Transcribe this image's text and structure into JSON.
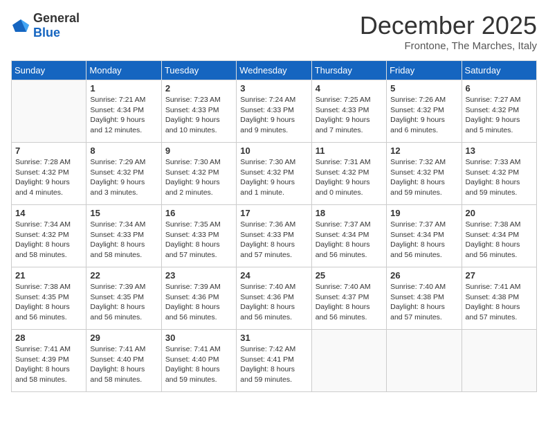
{
  "header": {
    "logo_general": "General",
    "logo_blue": "Blue",
    "month_title": "December 2025",
    "subtitle": "Frontone, The Marches, Italy"
  },
  "days_of_week": [
    "Sunday",
    "Monday",
    "Tuesday",
    "Wednesday",
    "Thursday",
    "Friday",
    "Saturday"
  ],
  "weeks": [
    [
      {
        "day": "",
        "info": ""
      },
      {
        "day": "1",
        "info": "Sunrise: 7:21 AM\nSunset: 4:34 PM\nDaylight: 9 hours\nand 12 minutes."
      },
      {
        "day": "2",
        "info": "Sunrise: 7:23 AM\nSunset: 4:33 PM\nDaylight: 9 hours\nand 10 minutes."
      },
      {
        "day": "3",
        "info": "Sunrise: 7:24 AM\nSunset: 4:33 PM\nDaylight: 9 hours\nand 9 minutes."
      },
      {
        "day": "4",
        "info": "Sunrise: 7:25 AM\nSunset: 4:33 PM\nDaylight: 9 hours\nand 7 minutes."
      },
      {
        "day": "5",
        "info": "Sunrise: 7:26 AM\nSunset: 4:32 PM\nDaylight: 9 hours\nand 6 minutes."
      },
      {
        "day": "6",
        "info": "Sunrise: 7:27 AM\nSunset: 4:32 PM\nDaylight: 9 hours\nand 5 minutes."
      }
    ],
    [
      {
        "day": "7",
        "info": "Sunrise: 7:28 AM\nSunset: 4:32 PM\nDaylight: 9 hours\nand 4 minutes."
      },
      {
        "day": "8",
        "info": "Sunrise: 7:29 AM\nSunset: 4:32 PM\nDaylight: 9 hours\nand 3 minutes."
      },
      {
        "day": "9",
        "info": "Sunrise: 7:30 AM\nSunset: 4:32 PM\nDaylight: 9 hours\nand 2 minutes."
      },
      {
        "day": "10",
        "info": "Sunrise: 7:30 AM\nSunset: 4:32 PM\nDaylight: 9 hours\nand 1 minute."
      },
      {
        "day": "11",
        "info": "Sunrise: 7:31 AM\nSunset: 4:32 PM\nDaylight: 9 hours\nand 0 minutes."
      },
      {
        "day": "12",
        "info": "Sunrise: 7:32 AM\nSunset: 4:32 PM\nDaylight: 8 hours\nand 59 minutes."
      },
      {
        "day": "13",
        "info": "Sunrise: 7:33 AM\nSunset: 4:32 PM\nDaylight: 8 hours\nand 59 minutes."
      }
    ],
    [
      {
        "day": "14",
        "info": "Sunrise: 7:34 AM\nSunset: 4:32 PM\nDaylight: 8 hours\nand 58 minutes."
      },
      {
        "day": "15",
        "info": "Sunrise: 7:34 AM\nSunset: 4:33 PM\nDaylight: 8 hours\nand 58 minutes."
      },
      {
        "day": "16",
        "info": "Sunrise: 7:35 AM\nSunset: 4:33 PM\nDaylight: 8 hours\nand 57 minutes."
      },
      {
        "day": "17",
        "info": "Sunrise: 7:36 AM\nSunset: 4:33 PM\nDaylight: 8 hours\nand 57 minutes."
      },
      {
        "day": "18",
        "info": "Sunrise: 7:37 AM\nSunset: 4:34 PM\nDaylight: 8 hours\nand 56 minutes."
      },
      {
        "day": "19",
        "info": "Sunrise: 7:37 AM\nSunset: 4:34 PM\nDaylight: 8 hours\nand 56 minutes."
      },
      {
        "day": "20",
        "info": "Sunrise: 7:38 AM\nSunset: 4:34 PM\nDaylight: 8 hours\nand 56 minutes."
      }
    ],
    [
      {
        "day": "21",
        "info": "Sunrise: 7:38 AM\nSunset: 4:35 PM\nDaylight: 8 hours\nand 56 minutes."
      },
      {
        "day": "22",
        "info": "Sunrise: 7:39 AM\nSunset: 4:35 PM\nDaylight: 8 hours\nand 56 minutes."
      },
      {
        "day": "23",
        "info": "Sunrise: 7:39 AM\nSunset: 4:36 PM\nDaylight: 8 hours\nand 56 minutes."
      },
      {
        "day": "24",
        "info": "Sunrise: 7:40 AM\nSunset: 4:36 PM\nDaylight: 8 hours\nand 56 minutes."
      },
      {
        "day": "25",
        "info": "Sunrise: 7:40 AM\nSunset: 4:37 PM\nDaylight: 8 hours\nand 56 minutes."
      },
      {
        "day": "26",
        "info": "Sunrise: 7:40 AM\nSunset: 4:38 PM\nDaylight: 8 hours\nand 57 minutes."
      },
      {
        "day": "27",
        "info": "Sunrise: 7:41 AM\nSunset: 4:38 PM\nDaylight: 8 hours\nand 57 minutes."
      }
    ],
    [
      {
        "day": "28",
        "info": "Sunrise: 7:41 AM\nSunset: 4:39 PM\nDaylight: 8 hours\nand 58 minutes."
      },
      {
        "day": "29",
        "info": "Sunrise: 7:41 AM\nSunset: 4:40 PM\nDaylight: 8 hours\nand 58 minutes."
      },
      {
        "day": "30",
        "info": "Sunrise: 7:41 AM\nSunset: 4:40 PM\nDaylight: 8 hours\nand 59 minutes."
      },
      {
        "day": "31",
        "info": "Sunrise: 7:42 AM\nSunset: 4:41 PM\nDaylight: 8 hours\nand 59 minutes."
      },
      {
        "day": "",
        "info": ""
      },
      {
        "day": "",
        "info": ""
      },
      {
        "day": "",
        "info": ""
      }
    ]
  ]
}
